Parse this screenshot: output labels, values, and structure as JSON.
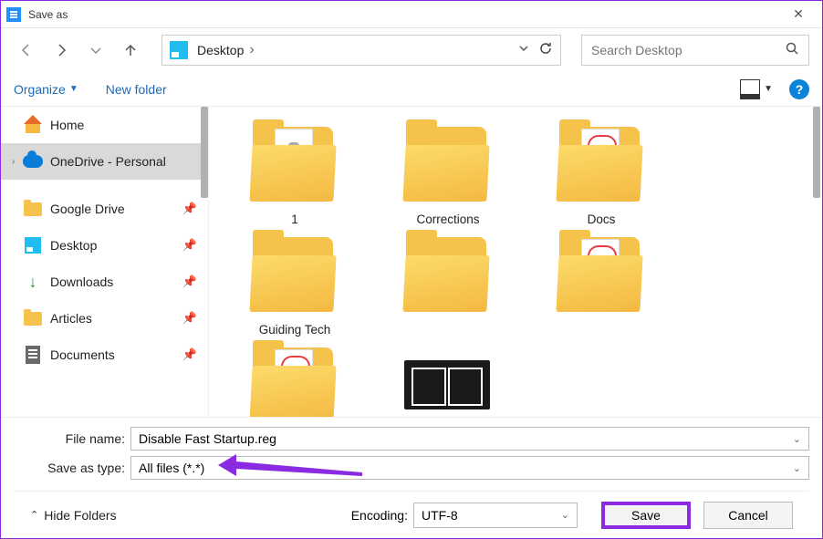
{
  "window": {
    "title": "Save as"
  },
  "nav": {
    "location": "Desktop",
    "search_placeholder": "Search Desktop"
  },
  "cmdbar": {
    "organize": "Organize",
    "new_folder": "New folder"
  },
  "sidebar": {
    "items": [
      {
        "label": "Home",
        "icon": "home",
        "pinned": false,
        "selected": false,
        "expandable": false
      },
      {
        "label": "OneDrive - Personal",
        "icon": "cloud",
        "pinned": false,
        "selected": true,
        "expandable": true
      },
      {
        "label": "Google Drive",
        "icon": "folder",
        "pinned": true,
        "selected": false,
        "expandable": false
      },
      {
        "label": "Desktop",
        "icon": "desktop",
        "pinned": true,
        "selected": false,
        "expandable": false
      },
      {
        "label": "Downloads",
        "icon": "download",
        "pinned": true,
        "selected": false,
        "expandable": false
      },
      {
        "label": "Articles",
        "icon": "folder",
        "pinned": true,
        "selected": false,
        "expandable": false
      },
      {
        "label": "Documents",
        "icon": "doc",
        "pinned": true,
        "selected": false,
        "expandable": false
      }
    ]
  },
  "folders": [
    {
      "name": "1",
      "overlay": "tool"
    },
    {
      "name": "Corrections",
      "overlay": "none"
    },
    {
      "name": "Docs",
      "overlay": "pdf"
    },
    {
      "name": "Guiding Tech",
      "overlay": "none"
    },
    {
      "name": "",
      "overlay": "none"
    },
    {
      "name": "",
      "overlay": "pdf"
    },
    {
      "name": "",
      "overlay": "pdf"
    },
    {
      "name": "",
      "overlay": "dark"
    }
  ],
  "form": {
    "filename_label": "File name:",
    "filename_value": "Disable Fast Startup.reg",
    "type_label": "Save as type:",
    "type_value": "All files  (*.*)"
  },
  "footer": {
    "hide_folders": "Hide Folders",
    "encoding_label": "Encoding:",
    "encoding_value": "UTF-8",
    "save": "Save",
    "cancel": "Cancel"
  }
}
